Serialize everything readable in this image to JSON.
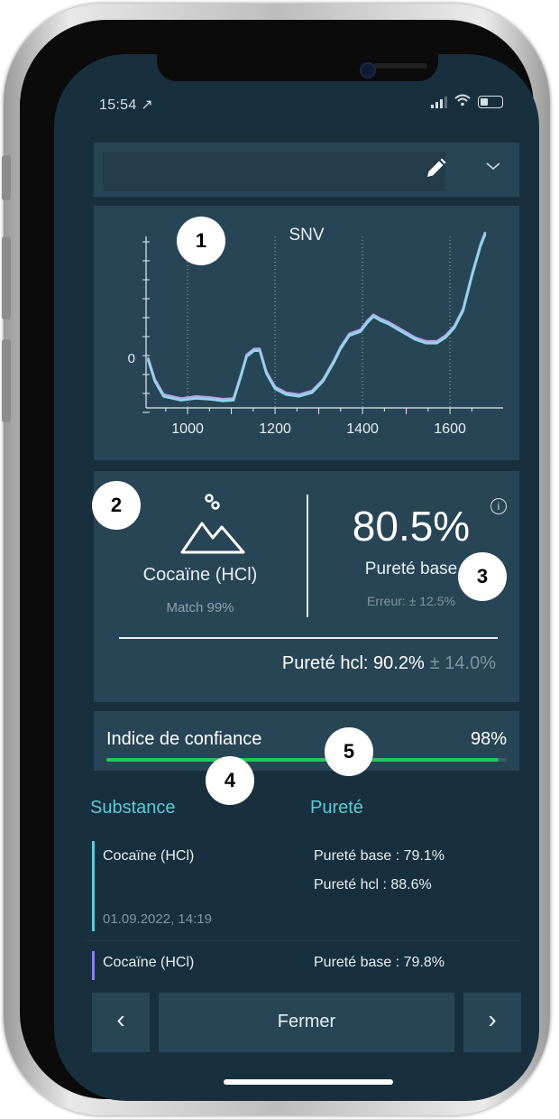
{
  "status_bar": {
    "time": "15:54 ↗"
  },
  "chart_data": {
    "type": "line",
    "title": "SNV",
    "x_ticks": [
      1000,
      1200,
      1400,
      1600
    ],
    "y_tick": "0",
    "xlim": [
      905,
      1705
    ],
    "ylim": [
      -1.3,
      3.3
    ],
    "series": [
      {
        "x": [
          910,
          925,
          945,
          985,
          1020,
          1055,
          1080,
          1105,
          1120,
          1135,
          1152,
          1165,
          1180,
          1200,
          1225,
          1255,
          1285,
          1310,
          1335,
          1350,
          1370,
          1395,
          1412,
          1425,
          1440,
          1460,
          1490,
          1520,
          1545,
          1570,
          1590,
          1610,
          1630,
          1650,
          1670,
          1680
        ],
        "y": [
          0,
          -0.55,
          -0.95,
          -1.05,
          -1.0,
          -1.03,
          -1.07,
          -1.05,
          -0.5,
          0.1,
          0.25,
          0.25,
          -0.35,
          -0.75,
          -0.9,
          -0.95,
          -0.85,
          -0.55,
          -0.05,
          0.3,
          0.65,
          0.75,
          1.0,
          1.15,
          1.05,
          0.95,
          0.75,
          0.55,
          0.45,
          0.45,
          0.6,
          0.85,
          1.3,
          2.2,
          3.0,
          3.3
        ]
      },
      {
        "x": [
          910,
          925,
          945,
          985,
          1020,
          1055,
          1080,
          1105,
          1120,
          1135,
          1152,
          1165,
          1180,
          1200,
          1225,
          1255,
          1285,
          1310,
          1335,
          1350,
          1370,
          1395,
          1412,
          1425,
          1440,
          1460,
          1490,
          1520,
          1545,
          1570,
          1590,
          1610,
          1630,
          1650,
          1670,
          1680
        ],
        "y": [
          -0.05,
          -0.6,
          -1.0,
          -1.1,
          -1.05,
          -1.08,
          -1.12,
          -1.1,
          -0.55,
          0.05,
          0.2,
          0.2,
          -0.4,
          -0.8,
          -0.95,
          -1.0,
          -0.9,
          -0.6,
          -0.1,
          0.25,
          0.6,
          0.7,
          0.95,
          1.1,
          1.0,
          0.9,
          0.7,
          0.5,
          0.4,
          0.4,
          0.55,
          0.8,
          1.25,
          2.15,
          2.95,
          3.25
        ]
      }
    ],
    "grid": true
  },
  "result": {
    "substance": "Cocaïne (HCl)",
    "match": "Match 99%",
    "purity_value": "80.5%",
    "purity_label": "Pureté base",
    "purity_error": "Erreur: ± 12.5%",
    "hcl_purity": "Pureté hcl: 90.2%",
    "hcl_error": "± 14.0%"
  },
  "confidence": {
    "label": "Indice de confiance",
    "value": "98%",
    "level": 0.98,
    "color": "#22c55e"
  },
  "history": {
    "col_substance": "Substance",
    "col_purity": "Pureté",
    "rows": [
      {
        "substance": "Cocaïne (HCl)",
        "purity_base": "Pureté base : 79.1%",
        "purity_hcl": "Pureté hcl : 88.6%",
        "date": "01.09.2022, 14:19",
        "accent": "#5ec8d8"
      },
      {
        "substance": "Cocaïne (HCl)",
        "purity_base": "Pureté base : 79.8%",
        "accent": "#8d7cf0"
      }
    ]
  },
  "nav": {
    "prev": "‹",
    "close": "Fermer",
    "next": "›"
  },
  "badges": [
    "1",
    "2",
    "3",
    "4",
    "5"
  ]
}
